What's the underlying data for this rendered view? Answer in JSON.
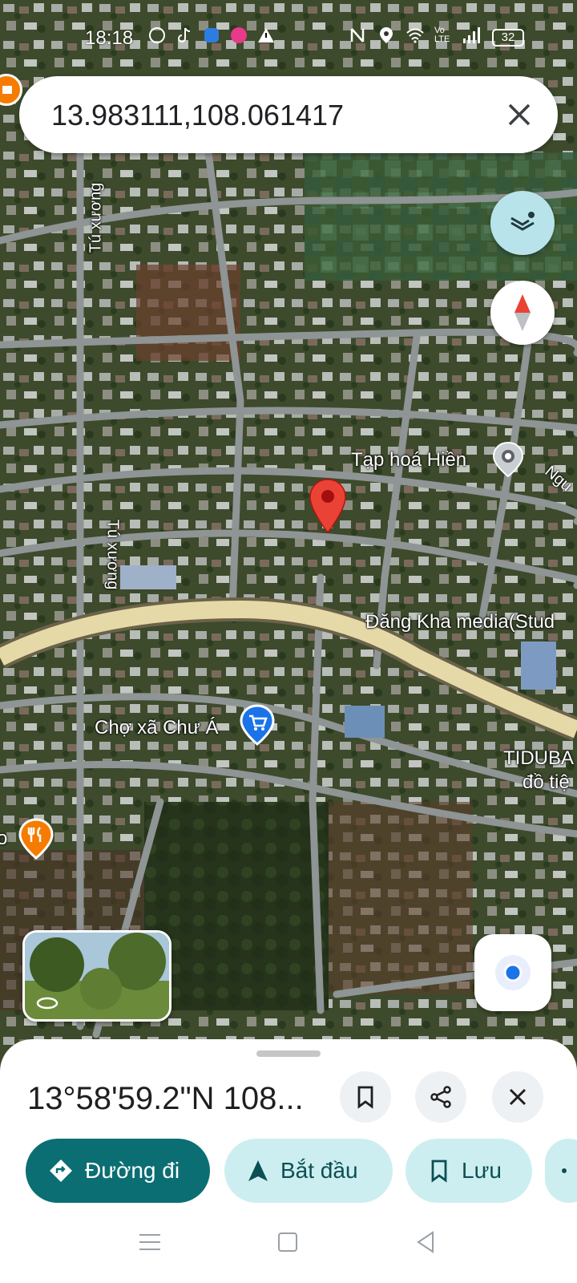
{
  "status_bar": {
    "time": "18:18",
    "battery": "32",
    "network": "Vo LTE"
  },
  "search": {
    "query": "13.983111,108.061417"
  },
  "map": {
    "labels": {
      "shop": "Tạp hoá Hiền",
      "media": "Đăng Kha media(Stud",
      "market": "Chợ xã Chư Á",
      "tiduba_line1": "TIDUBA",
      "tiduba_line2": "đồ tiệ",
      "road_tu_xuong_1": "Tú xương",
      "road_tu_xuong_2": "Tú xương",
      "road_ngu": "Ngu",
      "edge_left": "o"
    }
  },
  "sheet": {
    "coordinates": "13°58'59.2\"N 108...",
    "actions": {
      "directions": "Đường đi",
      "start": "Bắt đầu",
      "save": "Lưu"
    }
  },
  "colors": {
    "accent": "#0b6e73",
    "chip_secondary": "#cdeef0",
    "pin": "#d93025",
    "road": "#9aa0a6",
    "highway": "#e6d9a8"
  },
  "icons": {
    "pin": "map-pin-icon",
    "layers": "layers-icon",
    "compass": "compass-icon",
    "locate": "my-location-icon"
  }
}
